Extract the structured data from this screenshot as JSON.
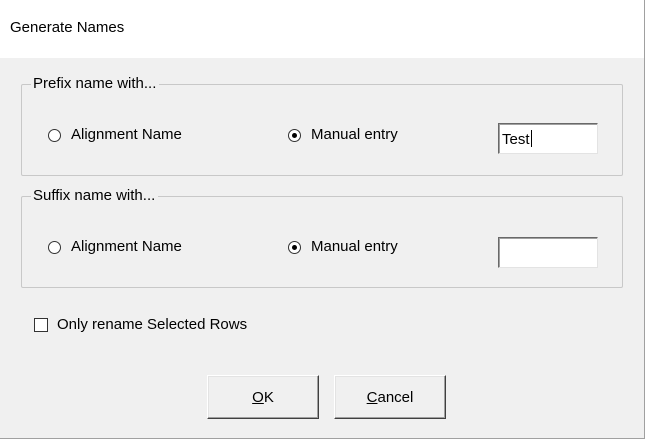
{
  "window": {
    "title": "Generate Names"
  },
  "prefix_group": {
    "legend": "Prefix name with...",
    "option_alignment": {
      "label": "Alignment Name",
      "checked": false
    },
    "option_manual": {
      "label": "Manual entry",
      "checked": true
    },
    "manual_value": "Test"
  },
  "suffix_group": {
    "legend": "Suffix name with...",
    "option_alignment": {
      "label": "Alignment Name",
      "checked": false
    },
    "option_manual": {
      "label": "Manual entry",
      "checked": true
    },
    "manual_value": ""
  },
  "only_selected": {
    "label": "Only rename Selected Rows",
    "checked": false
  },
  "buttons": {
    "ok": {
      "mnemonic": "O",
      "rest": "K"
    },
    "cancel": {
      "mnemonic": "C",
      "rest": "ancel"
    }
  }
}
